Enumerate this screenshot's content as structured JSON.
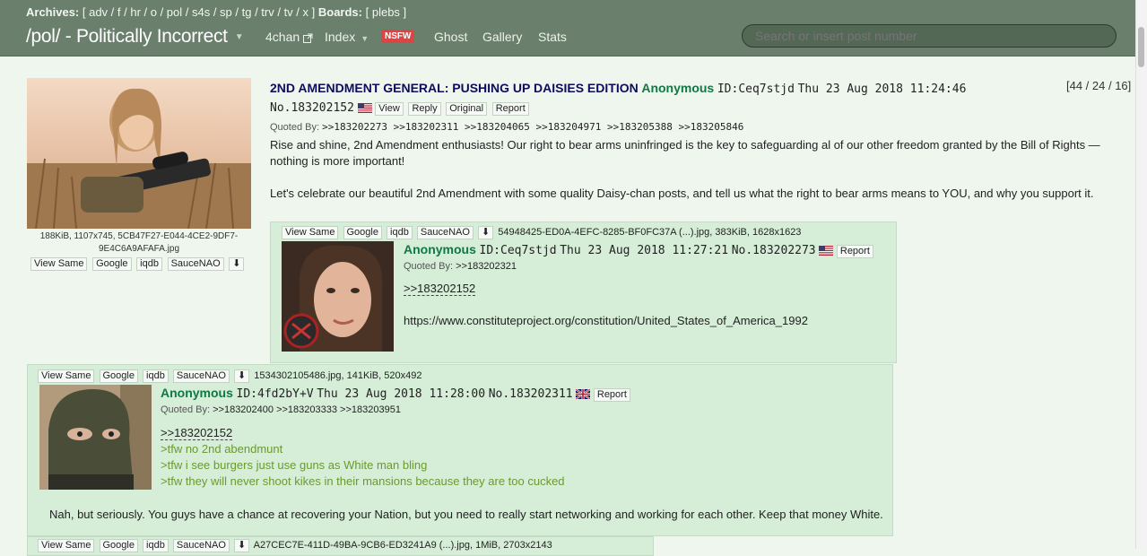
{
  "topbar": {
    "archives_label": "Archives:",
    "archives_links": "[ adv / f / hr / o / pol / s4s / sp / tg / trv / tv / x ]",
    "boards_label": "Boards:",
    "boards_links": "[ plebs ]",
    "board_title": "/pol/ - Politically Incorrect",
    "nav_4chan": "4chan",
    "nav_index": "Index",
    "nav_nsfw": "NSFW",
    "nav_ghost": "Ghost",
    "nav_gallery": "Gallery",
    "nav_stats": "Stats",
    "search_placeholder": "Search or insert post number"
  },
  "op": {
    "image_caption_1": "188KiB, 1107x745, 5CB47F27-E044-4CE2-9DF7-",
    "image_caption_2": "9E4C6A9AFAFA.jpg",
    "image_buttons": [
      "View Same",
      "Google",
      "iqdb",
      "SauceNAO"
    ],
    "subject": "2ND AMENDMENT GENERAL: PUSHING UP DAISIES EDITION",
    "name": "Anonymous",
    "id": "ID:Ceq7stjd",
    "date": "Thu 23 Aug 2018 11:24:46",
    "number": "No.183202152",
    "buttons": [
      "View",
      "Reply",
      "Original",
      "Report"
    ],
    "quoted_by_label": "Quoted By:",
    "quoted_by": ">>183202273 >>183202311 >>183204065 >>183204971 >>183205388 >>183205846",
    "counter": "[44 / 24 / 16]",
    "text_1": "Rise and shine, 2nd Amendment enthusiasts! Our right to bear arms uninfringed is the key to safeguarding al of our other freedom granted by the Bill of Rights —",
    "text_2": "nothing is more important!",
    "text_3": "Let's celebrate our beautiful 2nd Amendment with some quality Daisy-chan posts, and tell us what the right to bear arms means to YOU, and why you support it."
  },
  "reply1": {
    "image_buttons": [
      "View Same",
      "Google",
      "iqdb",
      "SauceNAO"
    ],
    "file_info": "54948425-ED0A-4EFC-8285-BF0FC37A (...).jpg, 383KiB, 1628x1623",
    "name": "Anonymous",
    "id": "ID:Ceq7stjd",
    "date": "Thu 23 Aug 2018 11:27:21",
    "number": "No.183202273",
    "report": "Report",
    "quoted_by_label": "Quoted By:",
    "quoted_by": ">>183202321",
    "quote_link": ">>183202152",
    "text": "https://www.constituteproject.org/constitution/United_States_of_America_1992"
  },
  "reply2": {
    "image_buttons": [
      "View Same",
      "Google",
      "iqdb",
      "SauceNAO"
    ],
    "file_info": "1534302105486.jpg, 141KiB, 520x492",
    "name": "Anonymous",
    "id": "ID:4fd2bY+V",
    "date": "Thu 23 Aug 2018 11:28:00",
    "number": "No.183202311",
    "report": "Report",
    "quoted_by_label": "Quoted By:",
    "quoted_by": ">>183202400 >>183203333 >>183203951",
    "quote_link": ">>183202152",
    "greentext": [
      ">tfw no 2nd abendmunt",
      ">tfw i see burgers just use guns as White man bling",
      ">tfw they will never shoot kikes in their mansions because they are too cucked"
    ],
    "text": "Nah, but seriously. You guys have a chance at recovering your Nation, but you need to really start networking and working for each other. Keep that money White."
  },
  "reply3": {
    "image_buttons": [
      "View Same",
      "Google",
      "iqdb",
      "SauceNAO"
    ],
    "file_info": "A27CEC7E-411D-49BA-9CB6-ED3241A9 (...).jpg, 1MiB, 2703x2143"
  },
  "colors": {
    "topbar": "#6b7f6d",
    "background": "#eef6ee",
    "reply_bg": "#d6eed8",
    "subject": "#0f0c5d",
    "name": "#117743",
    "greentext": "#6a9a2f",
    "nsfw": "#dd4444"
  }
}
